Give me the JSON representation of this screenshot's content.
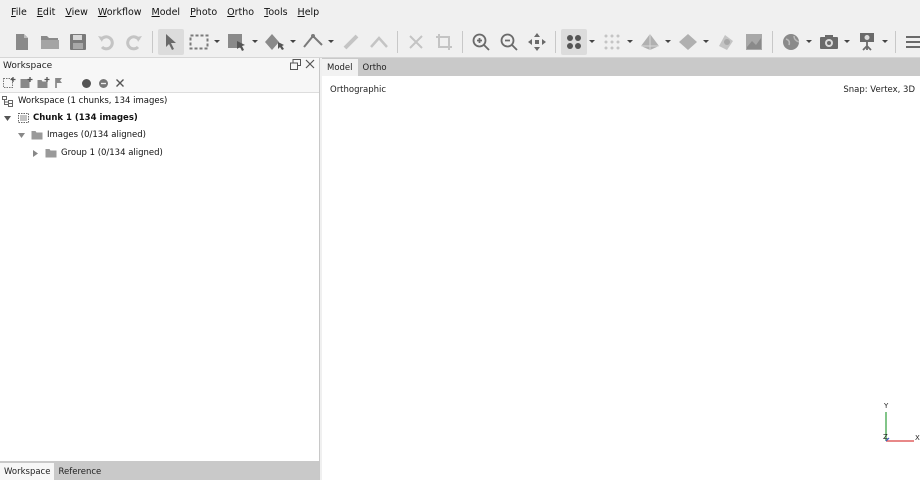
{
  "menu": [
    {
      "acc": "F",
      "rest": "ile"
    },
    {
      "acc": "E",
      "rest": "dit"
    },
    {
      "acc": "V",
      "rest": "iew"
    },
    {
      "acc": "W",
      "rest": "orkflow"
    },
    {
      "acc": "M",
      "rest": "odel"
    },
    {
      "acc": "P",
      "rest": "hoto"
    },
    {
      "acc": "O",
      "rest": "rtho"
    },
    {
      "acc": "T",
      "rest": "ools"
    },
    {
      "acc": "H",
      "rest": "elp"
    }
  ],
  "toolbar": {
    "icons": [
      "new-document-icon",
      "open-folder-icon",
      "save-icon",
      "undo-icon",
      "redo-icon",
      "navigation-arrow-icon",
      "rectangle-selection-icon",
      "shape-selection-icon",
      "draw-shape-icon",
      "ruler-icon",
      "measure-angle-icon",
      "delete-icon",
      "crop-icon",
      "zoom-in-icon",
      "zoom-out-icon",
      "reset-view-icon",
      "point-cloud-icon",
      "sparse-cloud-icon",
      "mesh-icon",
      "tiled-model-icon",
      "texture-icon",
      "dem-icon",
      "globe-icon",
      "camera-icon",
      "show-cameras-icon",
      "menu-icon"
    ]
  },
  "workspace": {
    "title": "Workspace",
    "tree": {
      "root": "Workspace (1 chunks, 134 images)",
      "chunk": "Chunk 1 (134 images)",
      "images": "Images (0/134 aligned)",
      "group": "Group 1 (0/134 aligned)"
    },
    "bottom_tabs": [
      "Workspace",
      "Reference"
    ]
  },
  "view": {
    "tabs": [
      "Model",
      "Ortho"
    ],
    "mode": "Orthographic",
    "snap": "Snap: Vertex, 3D",
    "axes": {
      "y": "Y",
      "z": "Z",
      "x": "X"
    }
  },
  "colors": {
    "axis_x": "#d94040",
    "axis_y": "#2f9e3a",
    "axis_z": "#3a58c9"
  }
}
